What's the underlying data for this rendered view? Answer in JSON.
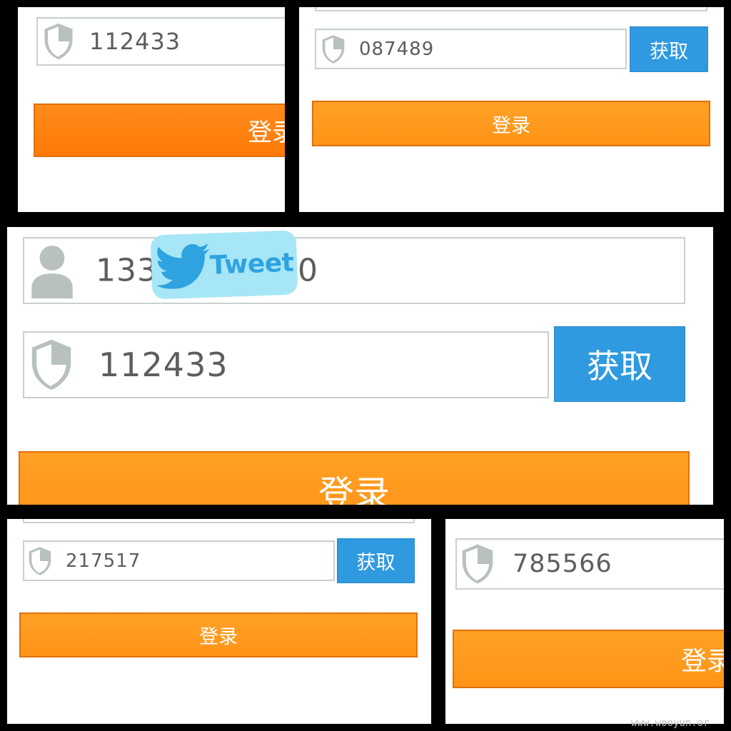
{
  "panel_1": {
    "code_value": "112433",
    "login_label": "登录"
  },
  "panel_2": {
    "code_value": "087489",
    "get_label": "获取",
    "login_label": "登录"
  },
  "panel_3": {
    "phone_value_left": "133",
    "phone_value_right": "0",
    "code_value": "112433",
    "get_label": "获取",
    "login_label": "登录"
  },
  "panel_4": {
    "code_value": "217517",
    "get_label": "获取",
    "login_label": "登录"
  },
  "panel_5": {
    "code_value": "785566",
    "login_label": "登录"
  },
  "overlay": {
    "tweet_label": "Tweet"
  },
  "watermark": "www.wooyun.or",
  "icons": {
    "shield": "shield-icon",
    "user": "user-icon",
    "bird": "twitter-bird-icon"
  },
  "colors": {
    "login_orange": "#ff9a1f",
    "get_blue": "#2f9ae0",
    "field_border": "#c9d0d0",
    "tweet_bg": "#a7e6f6"
  }
}
